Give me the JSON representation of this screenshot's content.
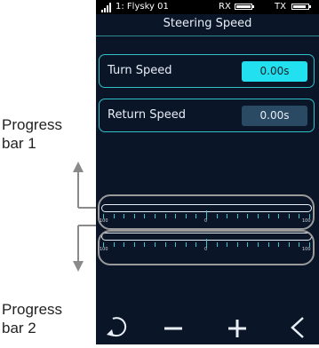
{
  "annotations": {
    "callout1": [
      "Progress",
      "bar 1"
    ],
    "callout2": [
      "Progress",
      "bar 2"
    ]
  },
  "status": {
    "model": "1: Flysky  01",
    "rx_label": "RX",
    "tx_label": "TX",
    "rx_battery_level": 1.0,
    "tx_battery_level": 0.85
  },
  "screen": {
    "title": "Steering Speed",
    "turn_speed": {
      "label": "Turn Speed",
      "value": "0.00s"
    },
    "return_speed": {
      "label": "Return Speed",
      "value": "0.00s"
    }
  },
  "progress_bars": [
    {
      "left_label": "100",
      "center_label": "0",
      "right_label": "100"
    },
    {
      "left_label": "100",
      "center_label": "0",
      "right_label": "100"
    }
  ],
  "toolbar": {
    "buttons": [
      "refresh-icon",
      "minus-icon",
      "plus-icon",
      "back-icon"
    ]
  },
  "colors": {
    "accent": "#22e0f0",
    "background": "#0a1628",
    "outline": "#2fc0c8"
  }
}
